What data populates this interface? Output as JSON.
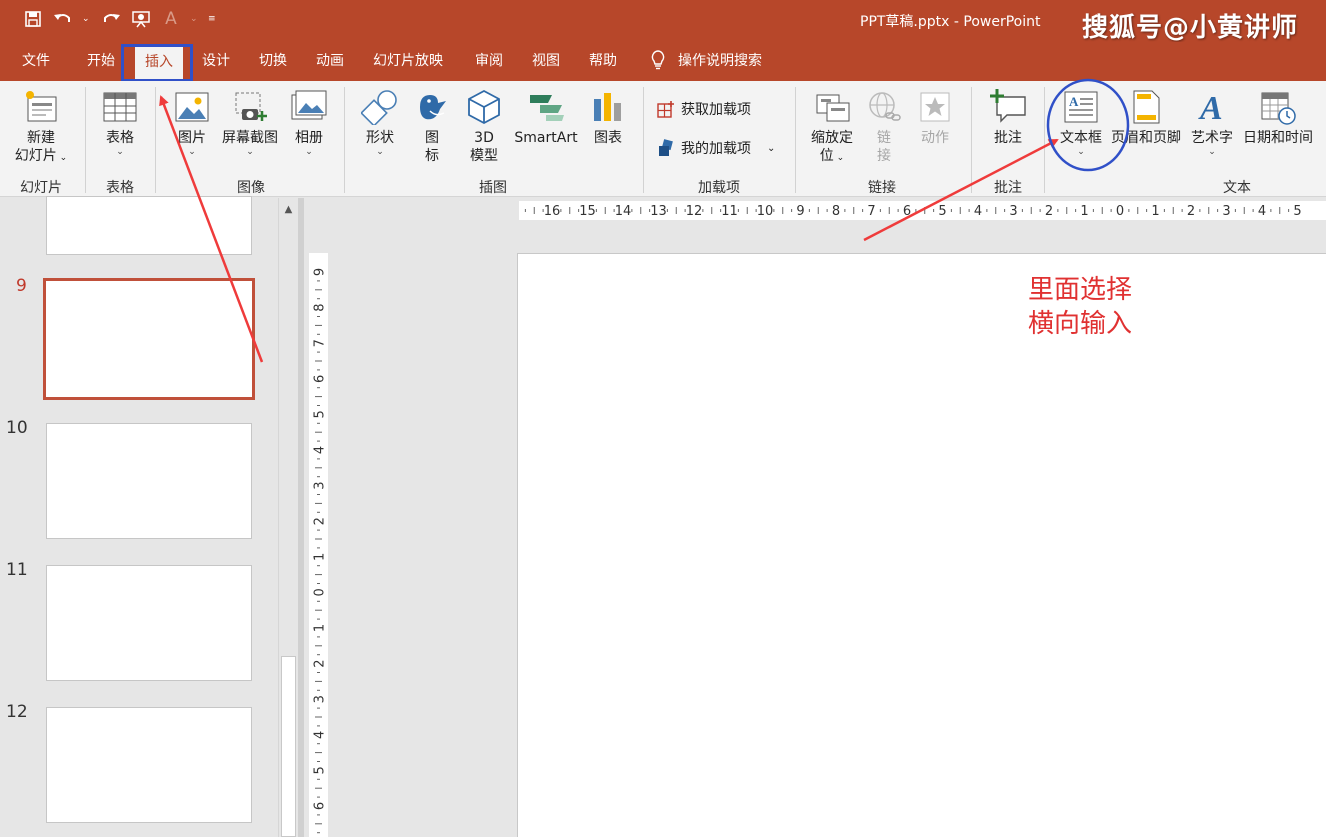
{
  "window": {
    "doc_title": "PPT草稿.pptx  -  PowerPoint",
    "watermark": "搜狐号@小黄讲师"
  },
  "tabs": [
    {
      "label": "文件"
    },
    {
      "label": "开始"
    },
    {
      "label": "插入",
      "active": true
    },
    {
      "label": "设计"
    },
    {
      "label": "切换"
    },
    {
      "label": "动画"
    },
    {
      "label": "幻灯片放映"
    },
    {
      "label": "审阅"
    },
    {
      "label": "视图"
    },
    {
      "label": "帮助"
    }
  ],
  "tell_me": "操作说明搜索",
  "ribbon": {
    "groups": {
      "slides": "幻灯片",
      "tables": "表格",
      "images": "图像",
      "illustrations": "插图",
      "addins": "加载项",
      "links": "链接",
      "comments": "批注",
      "text": "文本"
    },
    "buttons": {
      "new_slide_1": "新建",
      "new_slide_2": "幻灯片",
      "table": "表格",
      "pictures": "图片",
      "screenshot": "屏幕截图",
      "album": "相册",
      "shapes": "形状",
      "icons_1": "图",
      "icons_2": "标",
      "model3d_1": "3D",
      "model3d_2": "模型",
      "smartart": "SmartArt",
      "chart": "图表",
      "get_addins": "获取加载项",
      "my_addins": "我的加载项",
      "zoom_1": "缩放定",
      "zoom_2": "位",
      "link_1": "链",
      "link_2": "接",
      "action": "动作",
      "comment": "批注",
      "textbox": "文本框",
      "header_footer": "页眉和页脚",
      "wordart": "艺术字",
      "datetime": "日期和时间"
    }
  },
  "slides": [
    {
      "number": "9",
      "current": true
    },
    {
      "number": "10"
    },
    {
      "number": "11"
    },
    {
      "number": "12"
    }
  ],
  "ruler": {
    "horizontal": [
      "16",
      "15",
      "14",
      "13",
      "12",
      "11",
      "10",
      "9",
      "8",
      "7",
      "6",
      "5",
      "4",
      "3",
      "2",
      "1",
      "0",
      "1",
      "2",
      "3",
      "4",
      "5"
    ],
    "vertical": [
      "9",
      "8",
      "7",
      "6",
      "5",
      "4",
      "3",
      "2",
      "1",
      "0",
      "1",
      "2",
      "3",
      "4",
      "5",
      "6"
    ]
  },
  "annotation": {
    "line1": "里面选择",
    "line2": "横向输入"
  },
  "colors": {
    "accent": "#b7472a",
    "annotation": "#e03131",
    "highlight_box": "#3050c8"
  }
}
